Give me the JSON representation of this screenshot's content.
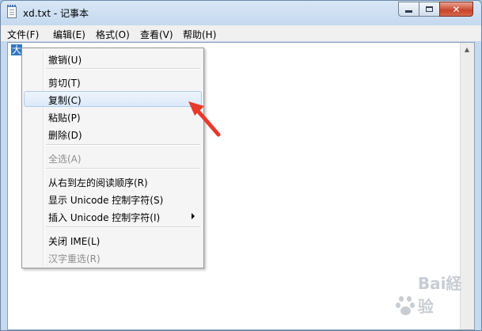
{
  "window": {
    "title": "xd.txt - 记事本",
    "close_glyph": "✕"
  },
  "menubar": {
    "items": [
      "文件(F)",
      "编辑(E)",
      "格式(O)",
      "查看(V)",
      "帮助(H)"
    ]
  },
  "editor": {
    "ime_char": "大"
  },
  "context_menu": {
    "items": [
      {
        "label": "撤销(U)",
        "disabled": false
      },
      {
        "label": "剪切(T)",
        "disabled": false
      },
      {
        "label": "复制(C)",
        "disabled": false,
        "highlighted": true
      },
      {
        "label": "粘贴(P)",
        "disabled": false
      },
      {
        "label": "删除(D)",
        "disabled": false
      },
      {
        "label": "全选(A)",
        "disabled": true
      },
      {
        "label": "从右到左的阅读顺序(R)",
        "disabled": false
      },
      {
        "label": "显示 Unicode 控制字符(S)",
        "disabled": false
      },
      {
        "label": "插入 Unicode 控制字符(I)",
        "disabled": false,
        "submenu": true
      },
      {
        "label": "关闭 IME(L)",
        "disabled": false
      },
      {
        "label": "汉字重选(R)",
        "disabled": true
      }
    ]
  },
  "annotation": {
    "arrow_color": "#e8392b"
  },
  "watermark": {
    "text": "Bai経验",
    "icon": "paw-icon"
  }
}
